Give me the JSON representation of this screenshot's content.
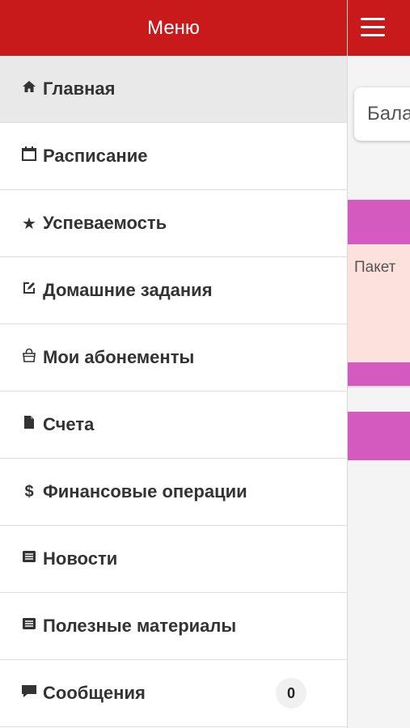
{
  "header": {
    "title": "Меню"
  },
  "menu": {
    "items": [
      {
        "label": "Главная",
        "icon": "home-icon",
        "active": true
      },
      {
        "label": "Расписание",
        "icon": "calendar-icon"
      },
      {
        "label": "Успеваемость",
        "icon": "star-icon"
      },
      {
        "label": "Домашние задания",
        "icon": "edit-icon"
      },
      {
        "label": "Мои абонементы",
        "icon": "bag-icon"
      },
      {
        "label": "Счета",
        "icon": "file-icon"
      },
      {
        "label": "Финансовые операции",
        "icon": "dollar-icon"
      },
      {
        "label": "Новости",
        "icon": "list-icon"
      },
      {
        "label": "Полезные материалы",
        "icon": "list-icon"
      },
      {
        "label": "Сообщения",
        "icon": "chat-icon",
        "badge": "0"
      }
    ]
  },
  "content": {
    "balance_label": "Бала",
    "package_label": "Пакет"
  },
  "colors": {
    "brand_red": "#c8191b",
    "accent_pink": "#d45ac0",
    "package_bg": "#fde1dd"
  }
}
